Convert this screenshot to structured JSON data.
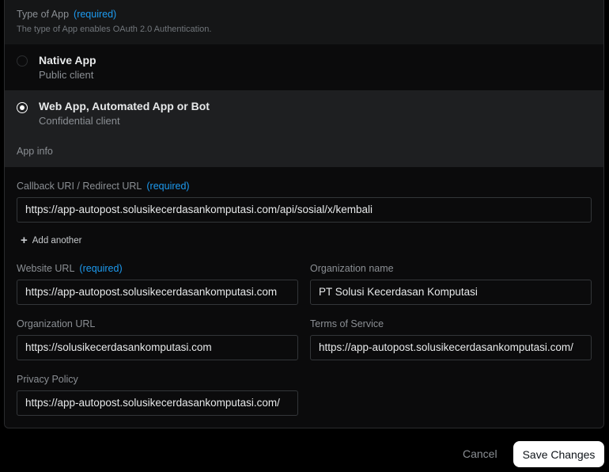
{
  "app_type": {
    "title": "Type of App",
    "required": "(required)",
    "subtitle": "The type of App enables OAuth 2.0 Authentication.",
    "options": [
      {
        "title": "Native App",
        "subtitle": "Public client",
        "selected": false
      },
      {
        "title": "Web App, Automated App or Bot",
        "subtitle": "Confidential client",
        "selected": true
      }
    ]
  },
  "app_info": {
    "title": "App info",
    "callback": {
      "label": "Callback URI / Redirect URL",
      "required": "(required)",
      "value": "https://app-autopost.solusikecerdasankomputasi.com/api/sosial/x/kembali"
    },
    "add_another": "Add another",
    "website": {
      "label": "Website URL",
      "required": "(required)",
      "value": "https://app-autopost.solusikecerdasankomputasi.com"
    },
    "org_name": {
      "label": "Organization name",
      "value": "PT Solusi Kecerdasan Komputasi"
    },
    "org_url": {
      "label": "Organization URL",
      "value": "https://solusikecerdasankomputasi.com"
    },
    "terms": {
      "label": "Terms of Service",
      "value": "https://app-autopost.solusikecerdasankomputasi.com/"
    },
    "privacy": {
      "label": "Privacy Policy",
      "value": "https://app-autopost.solusikecerdasankomputasi.com/"
    }
  },
  "actions": {
    "cancel": "Cancel",
    "save": "Save Changes"
  },
  "colors": {
    "accent": "#1d9bf0",
    "background": "#000000",
    "panel": "#151617"
  }
}
